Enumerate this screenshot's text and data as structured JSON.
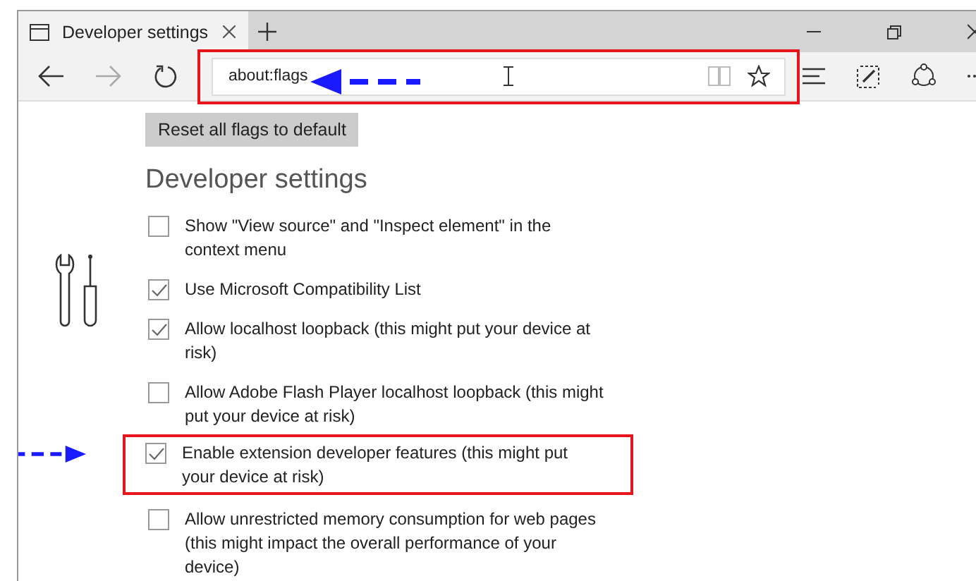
{
  "tab": {
    "title": "Developer settings"
  },
  "address_bar": {
    "value": "about:flags",
    "highlighted": true
  },
  "reset_button": "Reset all flags to default",
  "heading": "Developer settings",
  "flags": [
    {
      "label": "Show \"View source\" and \"Inspect element\" in the context menu",
      "checked": false,
      "highlighted": false
    },
    {
      "label": "Use Microsoft Compatibility List",
      "checked": true,
      "highlighted": false
    },
    {
      "label": "Allow localhost loopback (this might put your device at risk)",
      "checked": true,
      "highlighted": false
    },
    {
      "label": "Allow Adobe Flash Player localhost loopback (this might put your device at risk)",
      "checked": false,
      "highlighted": false
    },
    {
      "label": "Enable extension developer features (this might put your device at risk)",
      "checked": true,
      "highlighted": true
    },
    {
      "label": "Allow unrestricted memory consumption for web pages (this might impact the overall performance of your device)",
      "checked": false,
      "highlighted": false
    }
  ]
}
